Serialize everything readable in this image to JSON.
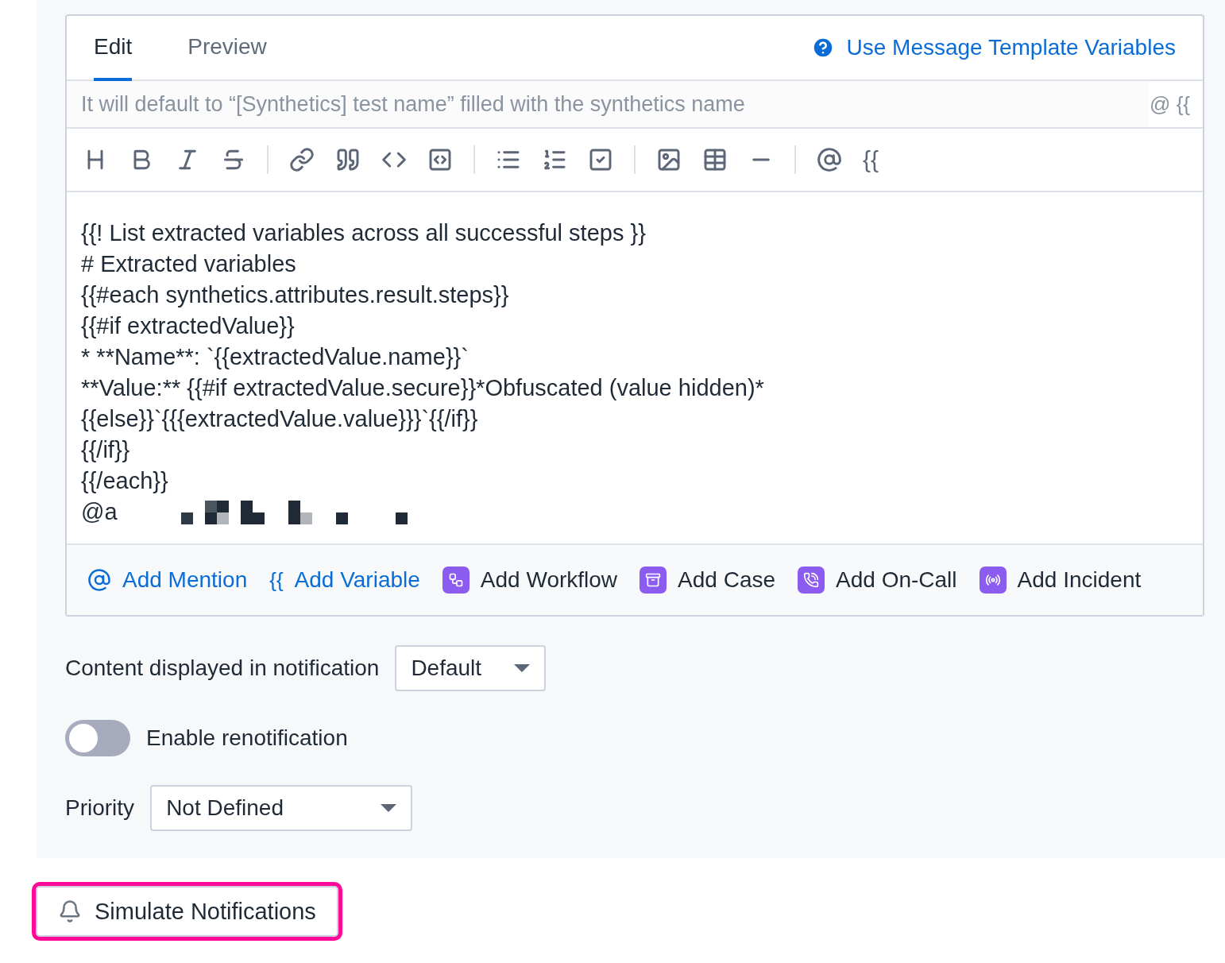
{
  "editor": {
    "tabs": [
      {
        "label": "Edit",
        "selected": true
      },
      {
        "label": "Preview",
        "selected": false
      }
    ],
    "help_link": "Use Message Template Variables",
    "subject": {
      "placeholder": "It will default to “[Synthetics] test name” filled with the synthetics name",
      "suffix": "@ {{"
    },
    "toolbar_variable_glyph": "{{",
    "body_lines": [
      "{{! List extracted variables across all successful steps }}",
      "# Extracted variables",
      "{{#each synthetics.attributes.result.steps}}",
      "{{#if extractedValue}}",
      "* **Name**: `{{extractedValue.name}}`",
      "**Value:** {{#if extractedValue.secure}}*Obfuscated (value hidden)*",
      "{{else}}`{{{extractedValue.value}}}`{{/if}}",
      "{{/if}}",
      "{{/each}}",
      "@a"
    ],
    "actions": [
      {
        "kind": "mention",
        "label": "Add Mention"
      },
      {
        "kind": "variable",
        "glyph": "{{",
        "label": "Add Variable"
      },
      {
        "kind": "workflow",
        "label": "Add Workflow"
      },
      {
        "kind": "case",
        "label": "Add Case"
      },
      {
        "kind": "oncall",
        "label": "Add On-Call"
      },
      {
        "kind": "incident",
        "label": "Add Incident"
      }
    ]
  },
  "content_display": {
    "label": "Content displayed in notification",
    "value": "Default"
  },
  "renotification": {
    "label": "Enable renotification",
    "on": false
  },
  "priority": {
    "label": "Priority",
    "value": "Not Defined"
  },
  "simulate_button": {
    "label": "Simulate Notifications",
    "focused": true
  }
}
